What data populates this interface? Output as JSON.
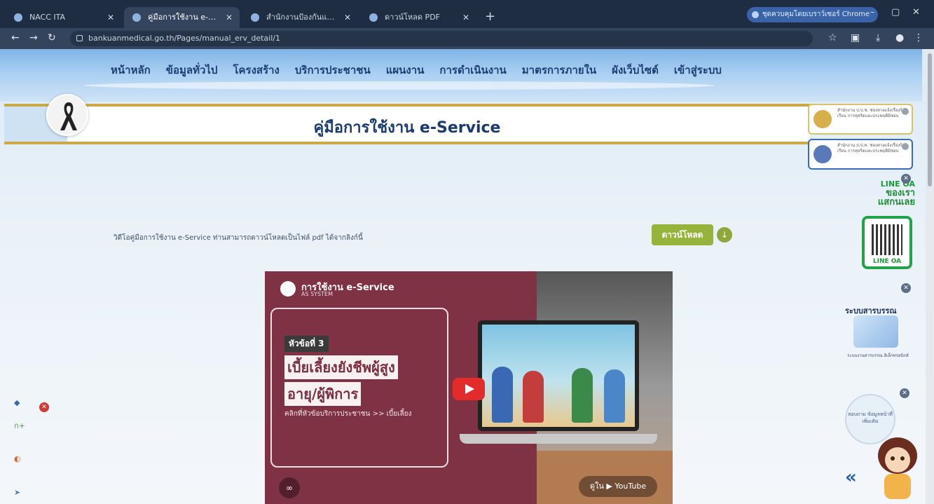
{
  "browser": {
    "tabs": [
      {
        "title": "NACC ITA"
      },
      {
        "title": "คู่มือการใช้งาน e-Service"
      },
      {
        "title": "สำนักงานป้องกันและปราบปรามการทุจริต"
      },
      {
        "title": "ดาวน์โหลด PDF"
      }
    ],
    "new_tab": "+",
    "profile_chip": "ชุดควบคุมโดยเบราว์เซอร์ Chrome",
    "url": "bankuanmedical.go.th/Pages/manual_erv_detail/1",
    "window_controls": {
      "minimize": "–",
      "maximize": "▢",
      "close": "✕"
    }
  },
  "site": {
    "menu": [
      "หน้าหลัก",
      "ข้อมูลทั่วไป",
      "โครงสร้าง",
      "บริการประชาชน",
      "แผนงาน",
      "การดำเนินงาน",
      "มาตรการภายใน",
      "ผังเว็บไซต์",
      "เข้าสู่ระบบ"
    ],
    "page_title": "คู่มือการใช้งาน e-Service",
    "info_text": "วิดีโอคู่มือการใช้งาน e-Service ท่านสามารถดาวน์โหลดเป็นไฟล์ pdf ได้จากลิงก์นี้",
    "download_label": "ดาวน์โหลด",
    "side_cards": [
      {
        "text": "สำนักงาน ป.ป.ช. ช่องทางแจ้งเรื่องร้องเรียน การทุจริตและประพฤติมิชอบ"
      },
      {
        "text": "สำนักงาน ป.ป.ท. ช่องทางแจ้งเรื่องร้องเรียน การทุจริตและประพฤติมิชอบ"
      }
    ],
    "line_widget": {
      "line1": "LINE OA",
      "line2": "ของเรา",
      "line3": "แสกนเลย",
      "qr_label": "LINE OA"
    },
    "sarabun": {
      "title": "ระบบสารบรรณ",
      "caption": "ระบบงานสารบรรณ อิเล็กทรอนิกส์"
    },
    "help_bubble": "สอบถาม ข้อมูลหน้าที่ เพิ่มเติม"
  },
  "video": {
    "channel_title": "การใช้งาน e-Service",
    "channel_sub": "AS SYSTEM",
    "chip": "หัวข้อที่ 3",
    "heading_line1": "เบี้ยเลี้ยงยังชีพผู้สูง",
    "heading_line2": "อายุ/ผู้พิการ",
    "subline": "คลิกที่หัวข้อบริการประชาชน >> เบี้ยเลี้ยง",
    "watch_label": "ดูใน ▶ YouTube"
  },
  "icons": {
    "back": "arrow-left-icon",
    "forward": "arrow-right-icon",
    "reload": "reload-icon",
    "star": "star-icon",
    "download": "download-icon",
    "link": "link-icon"
  },
  "colors": {
    "menu_text": "#1a3f73",
    "title_text": "#1b3b6f",
    "download_btn": "#96b33a",
    "video_bg": "#7f3244",
    "line_green": "#22a34a"
  }
}
